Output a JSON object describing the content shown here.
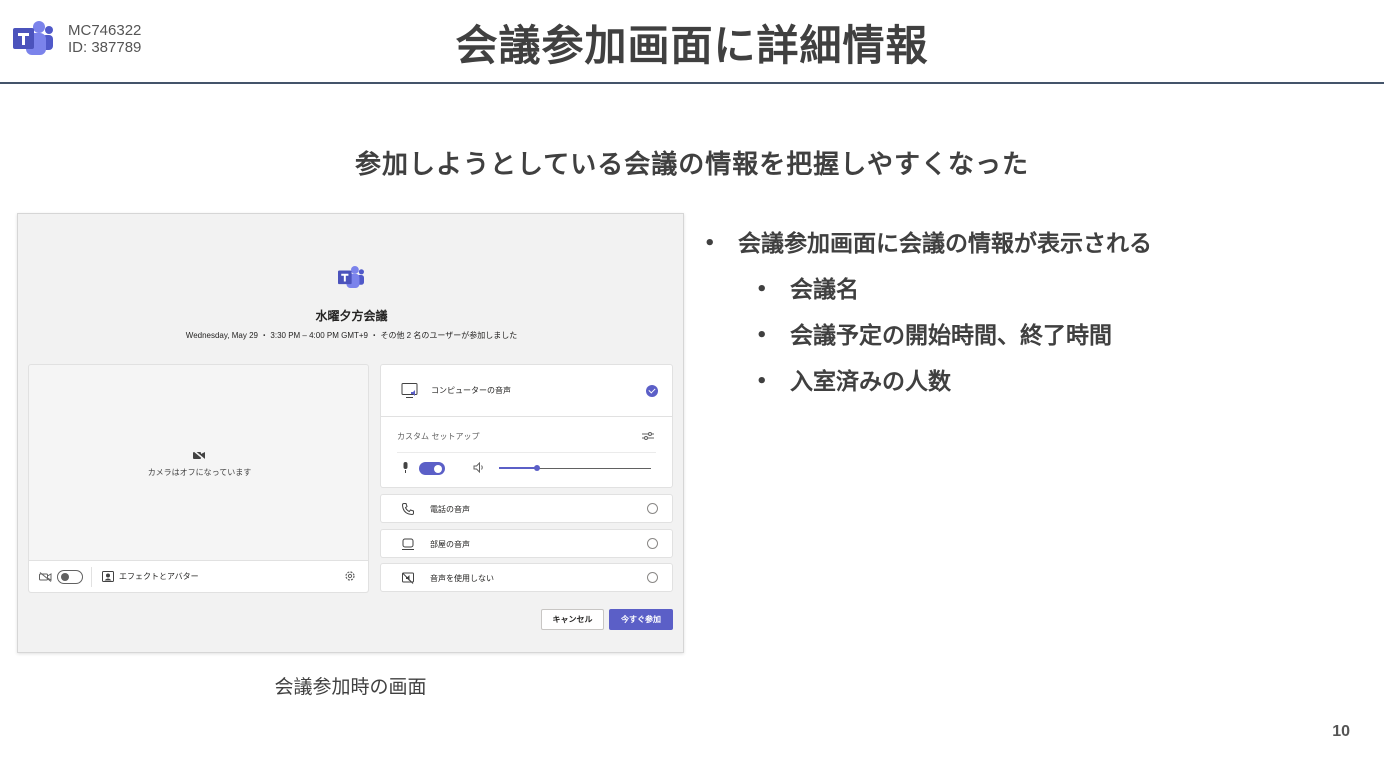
{
  "header": {
    "message_id": "MC746322",
    "id_line": "ID: 387789",
    "title": "会議参加画面に詳細情報",
    "logo_icon": "teams-logo-icon",
    "accent_color": "#44546a"
  },
  "subtitle": "参加しようとしている会議の情報を把握しやすくなった",
  "screenshot": {
    "meeting_name": "水曜夕方会議",
    "meeting_info": "Wednesday, May 29 ・ 3:30 PM – 4:00 PM GMT+9 ・ その他 2 名のユーザーが参加しました",
    "camera_off_text": "カメラはオフになっています",
    "effects_label": "エフェクトとアバター",
    "computer_audio_label": "コンピューターの音声",
    "custom_setup_label": "カスタム セットアップ",
    "volume_level": 0.25,
    "phone_audio_label": "電話の音声",
    "room_audio_label": "部屋の音声",
    "no_audio_label": "音声を使用しない",
    "cancel_label": "キャンセル",
    "join_label": "今すぐ参加",
    "brand_color": "#5b5fc7"
  },
  "caption": "会議参加時の画面",
  "bullets": {
    "main": "会議参加画面に会議の情報が表示される",
    "sub": [
      "会議名",
      "会議予定の開始時間、終了時間",
      "入室済みの人数"
    ]
  },
  "page_number": "10"
}
